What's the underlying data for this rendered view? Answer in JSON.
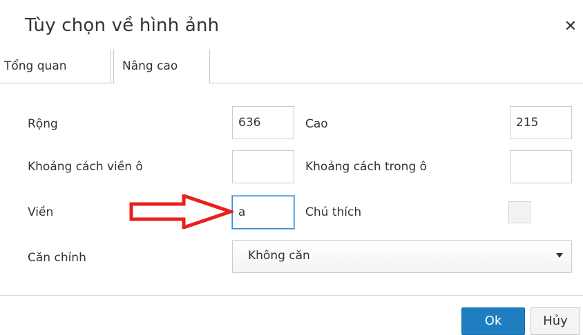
{
  "dialog": {
    "title": "Tùy chọn về hình ảnh",
    "close_icon": "close-icon"
  },
  "tabs": [
    {
      "label": "Tổng quan",
      "active": false
    },
    {
      "label": "Nâng cao",
      "active": true
    }
  ],
  "form": {
    "width_label": "Rộng",
    "width_value": "636",
    "height_label": "Cao",
    "height_value": "215",
    "hspace_label": "Khoảng cách viền ô",
    "hspace_value": "",
    "vspace_label": "Khoảng cách trong ô",
    "vspace_value": "",
    "border_label": "Viền",
    "border_value": "a",
    "caption_label": "Chú thích",
    "caption_checked": false,
    "align_label": "Căn chỉnh",
    "align_value": "Không căn"
  },
  "buttons": {
    "ok_label": "Ok",
    "cancel_label": "Hủy"
  },
  "annotation": {
    "arrow_color": "#e8211c",
    "arrow_target": "border-input"
  },
  "colors": {
    "ok_bg": "#1e7ec0",
    "focus_border": "#2f8fd8"
  }
}
